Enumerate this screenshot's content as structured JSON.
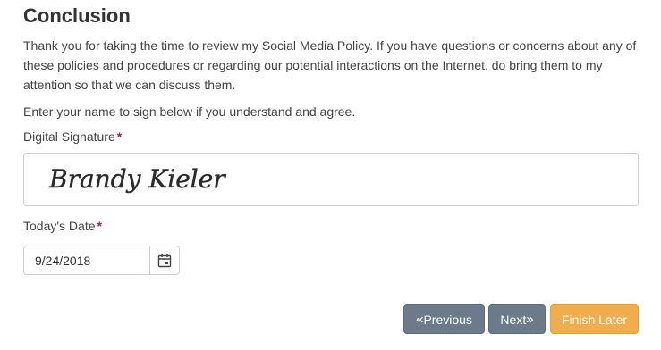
{
  "section": {
    "title": "Conclusion",
    "paragraph1": "Thank you for taking the time to review my Social Media Policy. If you have questions or concerns about any of these policies and procedures or regarding our potential interactions on the Internet, do bring them to my attention so that we can discuss them.",
    "paragraph2": "Enter your name to sign below if you understand and agree."
  },
  "signature": {
    "label": "Digital Signature",
    "required_marker": "*",
    "value": "Brandy Kieler"
  },
  "date": {
    "label": "Today's Date",
    "required_marker": "*",
    "value": "9/24/2018",
    "icon": "calendar-icon"
  },
  "buttons": {
    "previous_arrow": "«",
    "previous_label": "Previous",
    "next_label": "Next",
    "next_arrow": "»",
    "finish_label": "Finish Later"
  },
  "colors": {
    "required": "#b01a4c",
    "nav_button": "#6c7a89",
    "finish_button": "#f0ad4e"
  }
}
